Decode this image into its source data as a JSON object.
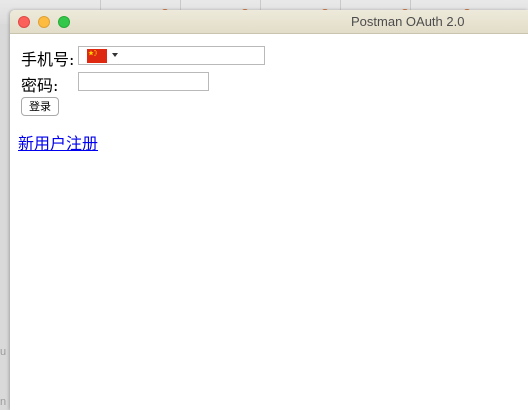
{
  "window": {
    "title": "Postman OAuth 2.0"
  },
  "background": {
    "edge_text_1": "u",
    "edge_text_2": "n"
  },
  "form": {
    "phone_label": "手机号:",
    "country_icon": "china-flag-icon",
    "phone_value": "",
    "password_label": "密码:",
    "password_value": "",
    "login_button_label": "登录",
    "register_link_label": "新用户注册"
  },
  "colors": {
    "link": "#0000ee",
    "close": "#fc605b",
    "minimize": "#fdbc40",
    "maximize": "#34c84a",
    "flag_red": "#de2910",
    "flag_yellow": "#ffde00"
  }
}
